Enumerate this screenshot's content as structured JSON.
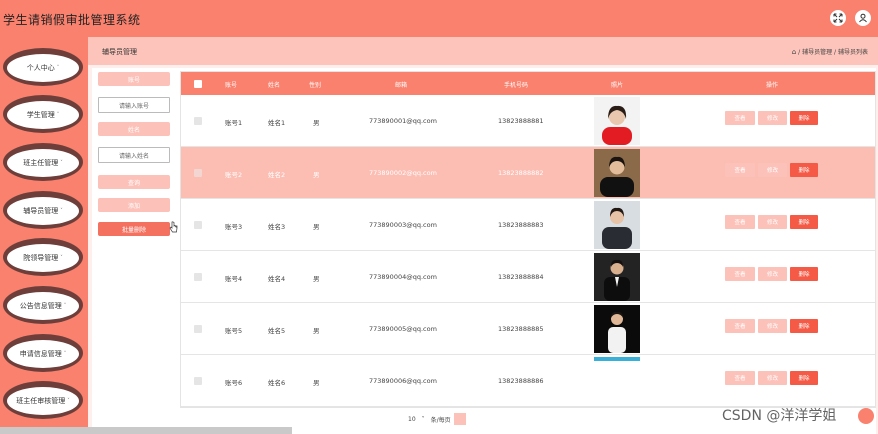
{
  "app": {
    "title": "学生请销假审批管理系统"
  },
  "topbar": {
    "icons": [
      "fullscreen-icon",
      "user-icon"
    ]
  },
  "sidebar": {
    "items": [
      {
        "label": "个人中心"
      },
      {
        "label": "学生管理"
      },
      {
        "label": "班主任管理"
      },
      {
        "label": "辅导员管理"
      },
      {
        "label": "院领导管理"
      },
      {
        "label": "公告信息管理"
      },
      {
        "label": "申请信息管理"
      },
      {
        "label": "班主任审核管理"
      }
    ]
  },
  "header": {
    "title": "辅导员管理",
    "breadcrumb": {
      "home_icon": "home-icon",
      "level1": "辅导员管理",
      "level2": "辅导员列表"
    }
  },
  "filters": {
    "top_button": "账号",
    "account_placeholder": "请输入账号",
    "name_label": "姓名",
    "name_placeholder": "请输入姓名",
    "search_button": "查询",
    "add_button": "添加",
    "batch_delete_button": "批量删除"
  },
  "table": {
    "columns": [
      "账号",
      "姓名",
      "性别",
      "邮箱",
      "手机号码",
      "照片",
      "操作"
    ],
    "actions": {
      "detail": "查看",
      "edit": "修改",
      "delete": "删除"
    },
    "rows": [
      {
        "account": "账号1",
        "name": "姓名1",
        "gender": "男",
        "email": "773890001@qq.com",
        "phone": "13823888881",
        "highlighted": false
      },
      {
        "account": "账号2",
        "name": "姓名2",
        "gender": "男",
        "email": "773890002@qq.com",
        "phone": "13823888882",
        "highlighted": true
      },
      {
        "account": "账号3",
        "name": "姓名3",
        "gender": "男",
        "email": "773890003@qq.com",
        "phone": "13823888883",
        "highlighted": false
      },
      {
        "account": "账号4",
        "name": "姓名4",
        "gender": "男",
        "email": "773890004@qq.com",
        "phone": "13823888884",
        "highlighted": false
      },
      {
        "account": "账号5",
        "name": "姓名5",
        "gender": "男",
        "email": "773890005@qq.com",
        "phone": "13823888885",
        "highlighted": false
      },
      {
        "account": "账号6",
        "name": "姓名6",
        "gender": "男",
        "email": "773890006@qq.com",
        "phone": "13823888886",
        "highlighted": false
      }
    ]
  },
  "pagination": {
    "page_size": "10",
    "per_page_label": "条/每页"
  },
  "watermark": "CSDN @洋洋学姐",
  "colors": {
    "primary": "#f9816e",
    "light": "#fcc1b8",
    "danger": "#f45a45",
    "sidebar_disc": "#6e3f3a"
  }
}
